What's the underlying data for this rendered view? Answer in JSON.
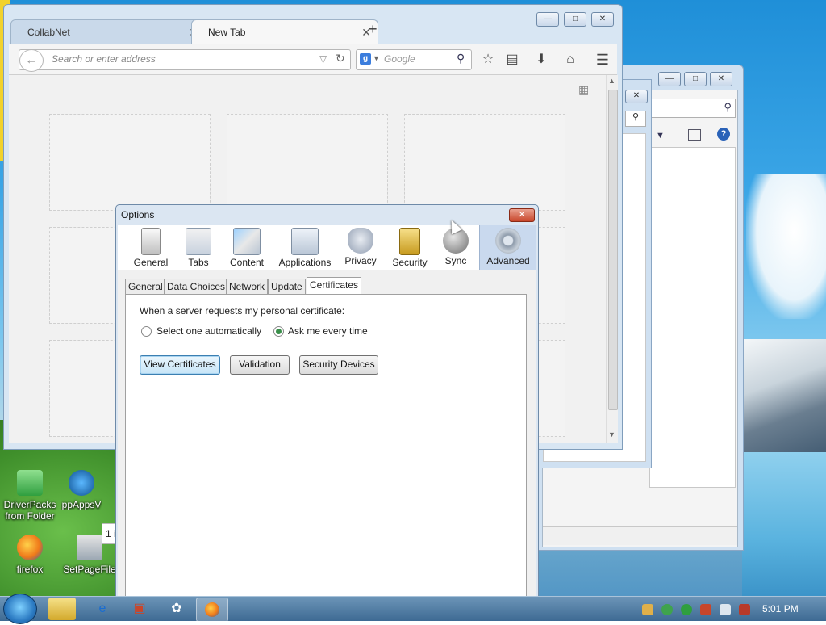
{
  "desktop": {
    "icons": [
      {
        "label_line1": "DriverPacks",
        "label_line2": "from Folder"
      },
      {
        "label_line1": "ppAppsV",
        "label_line2": ""
      },
      {
        "label_line1": "firefox",
        "label_line2": ""
      },
      {
        "label_line1": "SetPageFile",
        "label_line2": ""
      }
    ]
  },
  "background_window": {
    "status_text": "1 i"
  },
  "browser": {
    "tabs": [
      {
        "label": "CollabNet",
        "active": false
      },
      {
        "label": "New Tab",
        "active": true
      }
    ],
    "url_placeholder": "Search or enter address",
    "search_placeholder": "Google",
    "search_engine_badge": "g"
  },
  "options_dialog": {
    "title": "Options",
    "panes": [
      {
        "label": "General"
      },
      {
        "label": "Tabs"
      },
      {
        "label": "Content"
      },
      {
        "label": "Applications"
      },
      {
        "label": "Privacy"
      },
      {
        "label": "Security"
      },
      {
        "label": "Sync"
      },
      {
        "label": "Advanced",
        "selected": true
      }
    ],
    "subtabs": [
      {
        "label": "General"
      },
      {
        "label": "Data Choices"
      },
      {
        "label": "Network"
      },
      {
        "label": "Update"
      },
      {
        "label": "Certificates",
        "selected": true
      }
    ],
    "certificates": {
      "prompt": "When a server requests my personal certificate:",
      "option_auto": "Select one automatically",
      "option_ask": "Ask me every time",
      "selected_option": "ask",
      "btn_view": "View Certificates",
      "btn_validation": "Validation",
      "btn_devices": "Security Devices"
    }
  },
  "taskbar": {
    "clock": "5:01 PM"
  }
}
